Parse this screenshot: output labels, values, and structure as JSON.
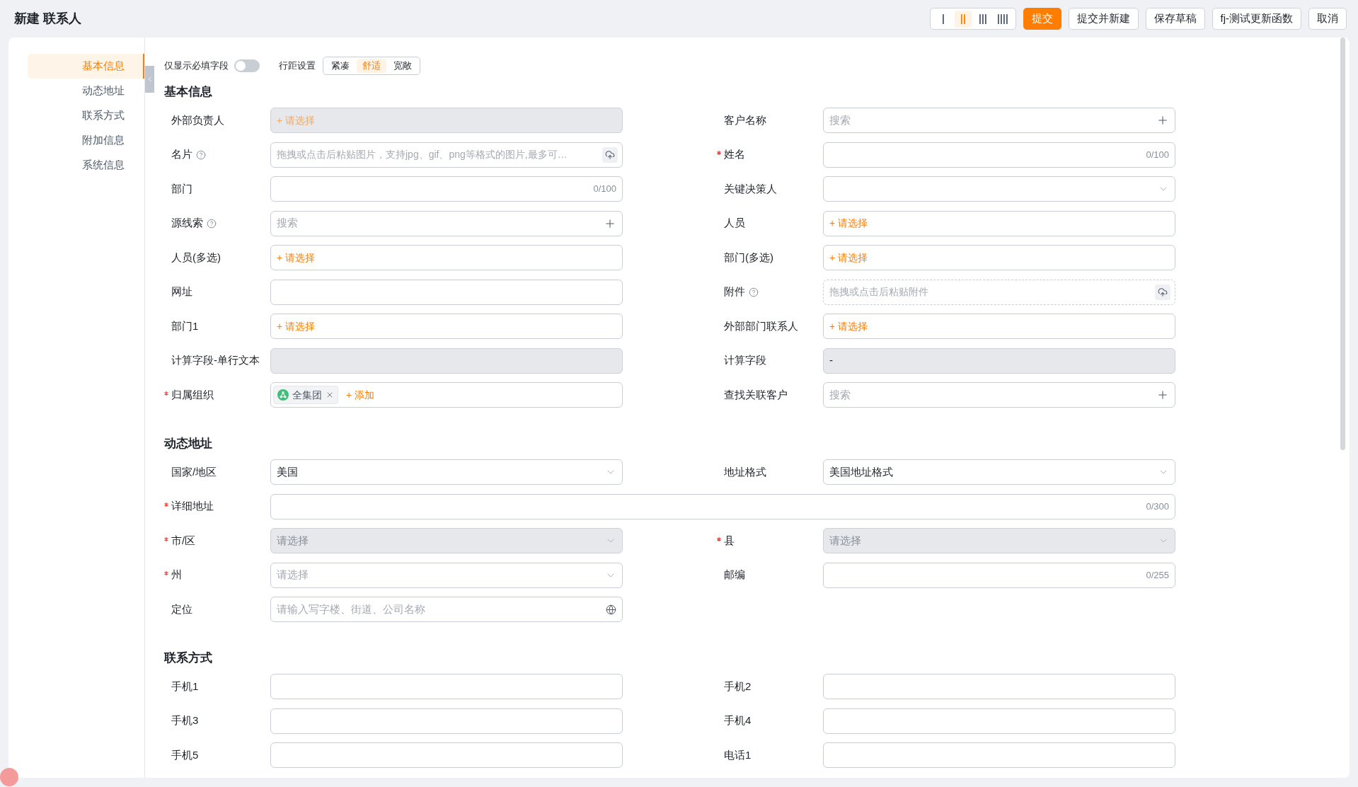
{
  "header": {
    "title": "新建 联系人",
    "density_options": [
      {
        "selected": false
      },
      {
        "selected": true
      },
      {
        "selected": false
      },
      {
        "selected": false
      }
    ],
    "buttons": [
      {
        "label": "提交",
        "kind": "primary"
      },
      {
        "label": "提交并新建",
        "kind": "default"
      },
      {
        "label": "保存草稿",
        "kind": "default"
      },
      {
        "label": "fj-测试更新函数",
        "kind": "default"
      },
      {
        "label": "取消",
        "kind": "default"
      }
    ]
  },
  "sidebar": {
    "items": [
      {
        "label": "基本信息",
        "selected": true
      },
      {
        "label": "动态地址",
        "selected": false
      },
      {
        "label": "联系方式",
        "selected": false
      },
      {
        "label": "附加信息",
        "selected": false
      },
      {
        "label": "系统信息",
        "selected": false
      }
    ]
  },
  "toolbar": {
    "required_only": {
      "label": "仅显示必填字段",
      "on": false
    },
    "spacing": {
      "label": "行距设置",
      "options": [
        {
          "label": "紧凑",
          "selected": false
        },
        {
          "label": "舒适",
          "selected": true
        },
        {
          "label": "宽敞",
          "selected": false
        }
      ]
    }
  },
  "sections": [
    {
      "title": "基本信息",
      "fields": [
        {
          "label": "外部负责人",
          "kind": "picker",
          "required": false,
          "help": false,
          "disabled": true,
          "action": "+ 请选择"
        },
        {
          "label": "客户名称",
          "kind": "search",
          "required": false,
          "help": false,
          "disabled": false,
          "placeholder": "搜索"
        },
        {
          "label": "名片",
          "kind": "image-upload",
          "required": false,
          "help": true,
          "disabled": false,
          "placeholder": "拖拽或点击后粘贴图片，支持jpg、gif、png等格式的图片,最多可…"
        },
        {
          "label": "姓名",
          "kind": "text",
          "required": true,
          "help": false,
          "disabled": false,
          "counter": "0/100"
        },
        {
          "label": "部门",
          "kind": "text",
          "required": false,
          "help": false,
          "disabled": false,
          "counter": "0/100"
        },
        {
          "label": "关键决策人",
          "kind": "select",
          "required": false,
          "help": false,
          "disabled": false
        },
        {
          "label": "源线索",
          "kind": "search",
          "required": false,
          "help": true,
          "disabled": false,
          "placeholder": "搜索"
        },
        {
          "label": "人员",
          "kind": "picker",
          "required": false,
          "help": false,
          "disabled": false,
          "action": "+ 请选择"
        },
        {
          "label": "人员(多选)",
          "kind": "picker",
          "required": false,
          "help": false,
          "disabled": false,
          "action": "+ 请选择"
        },
        {
          "label": "部门(多选)",
          "kind": "picker",
          "required": false,
          "help": false,
          "disabled": false,
          "action": "+ 请选择"
        },
        {
          "label": "网址",
          "kind": "text",
          "required": false,
          "help": false,
          "disabled": false
        },
        {
          "label": "附件",
          "kind": "file-upload",
          "required": false,
          "help": true,
          "disabled": false,
          "placeholder": "拖拽或点击后粘贴附件"
        },
        {
          "label": "部门1",
          "kind": "picker",
          "required": false,
          "help": false,
          "disabled": false,
          "action": "+ 请选择"
        },
        {
          "label": "外部部门联系人",
          "kind": "picker",
          "required": false,
          "help": false,
          "disabled": false,
          "action": "+ 请选择"
        },
        {
          "label": "计算字段-单行文本",
          "kind": "text",
          "required": false,
          "help": false,
          "disabled": true
        },
        {
          "label": "计算字段",
          "kind": "text",
          "required": false,
          "help": false,
          "disabled": true,
          "value": "-"
        },
        {
          "label": "归属组织",
          "kind": "org",
          "required": true,
          "help": false,
          "disabled": false,
          "tags": [
            {
              "label": "全集团"
            }
          ],
          "action": "+ 添加"
        },
        {
          "label": "查找关联客户",
          "kind": "search",
          "required": false,
          "help": false,
          "disabled": false,
          "placeholder": "搜索"
        }
      ]
    },
    {
      "title": "动态地址",
      "fields": [
        {
          "label": "国家/地区",
          "kind": "select",
          "required": false,
          "help": false,
          "disabled": false,
          "value": "美国"
        },
        {
          "label": "地址格式",
          "kind": "select",
          "required": false,
          "help": false,
          "disabled": false,
          "value": "美国地址格式"
        },
        {
          "label": "详细地址",
          "kind": "long-text",
          "required": true,
          "help": false,
          "disabled": false,
          "counter": "0/300"
        },
        {
          "label": "市/区",
          "kind": "select",
          "required": true,
          "help": false,
          "disabled": true,
          "placeholder": "请选择"
        },
        {
          "label": "县",
          "kind": "select",
          "required": true,
          "help": false,
          "disabled": true,
          "placeholder": "请选择"
        },
        {
          "label": "州",
          "kind": "select",
          "required": true,
          "help": false,
          "disabled": false,
          "placeholder": "请选择"
        },
        {
          "label": "邮编",
          "kind": "text",
          "required": false,
          "help": false,
          "disabled": false,
          "counter": "0/255"
        },
        {
          "label": "定位",
          "kind": "location",
          "required": false,
          "help": false,
          "disabled": false,
          "placeholder": "请输入写字楼、街道、公司名称"
        }
      ]
    },
    {
      "title": "联系方式",
      "fields": [
        {
          "label": "手机1",
          "kind": "text",
          "required": false,
          "help": false,
          "disabled": false
        },
        {
          "label": "手机2",
          "kind": "text",
          "required": false,
          "help": false,
          "disabled": false
        },
        {
          "label": "手机3",
          "kind": "text",
          "required": false,
          "help": false,
          "disabled": false
        },
        {
          "label": "手机4",
          "kind": "text",
          "required": false,
          "help": false,
          "disabled": false
        },
        {
          "label": "手机5",
          "kind": "text",
          "required": false,
          "help": false,
          "disabled": false
        },
        {
          "label": "电话1",
          "kind": "text",
          "required": false,
          "help": false,
          "disabled": false
        }
      ]
    }
  ]
}
